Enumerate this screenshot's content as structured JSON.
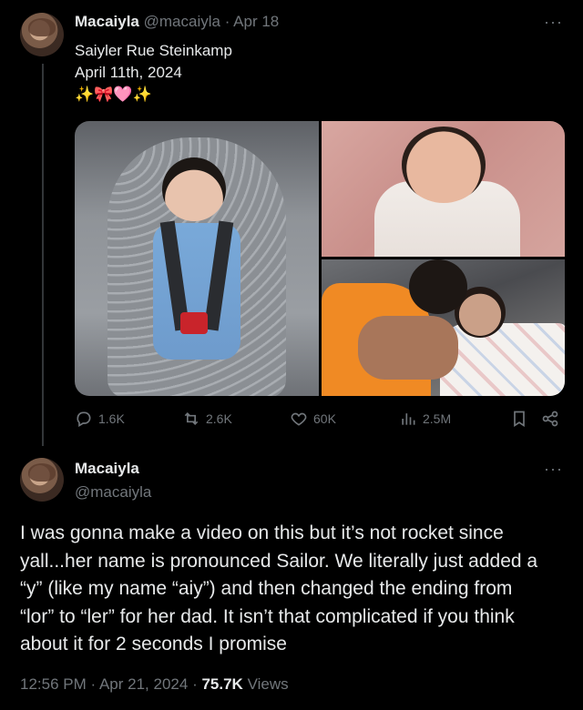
{
  "tweet1": {
    "display_name": "Macaiyla",
    "handle": "@macaiyla",
    "separator": "·",
    "date": "Apr 18",
    "more": "···",
    "text_lines": [
      "Saiyler Rue Steinkamp",
      "April 11th, 2024",
      "✨🎀🩷✨"
    ],
    "stats": {
      "replies": "1.6K",
      "reposts": "2.6K",
      "likes": "60K",
      "views": "2.5M"
    }
  },
  "tweet2": {
    "display_name": "Macaiyla",
    "handle": "@macaiyla",
    "more": "···",
    "body_lines": [
      "I was gonna make a video on this but it’s not rocket since",
      "yall...her name is pronounced Sailor. We literally just added a",
      "“y” (like my name “aiy”) and then changed the ending from",
      "“lor” to “ler” for her dad. It isn’t that complicated if you think",
      "about it for 2 seconds I promise"
    ],
    "time": "12:56 PM",
    "separator": "·",
    "date": "Apr 21, 2024",
    "views_count": "75.7K",
    "views_label": "Views"
  },
  "colors": {
    "background": "#000000",
    "text_primary": "#e7e9ea",
    "text_muted": "#71767b",
    "thread_line": "#333639"
  },
  "icons": [
    "reply-icon",
    "repost-icon",
    "like-icon",
    "views-icon",
    "bookmark-icon",
    "share-icon",
    "more-icon"
  ]
}
